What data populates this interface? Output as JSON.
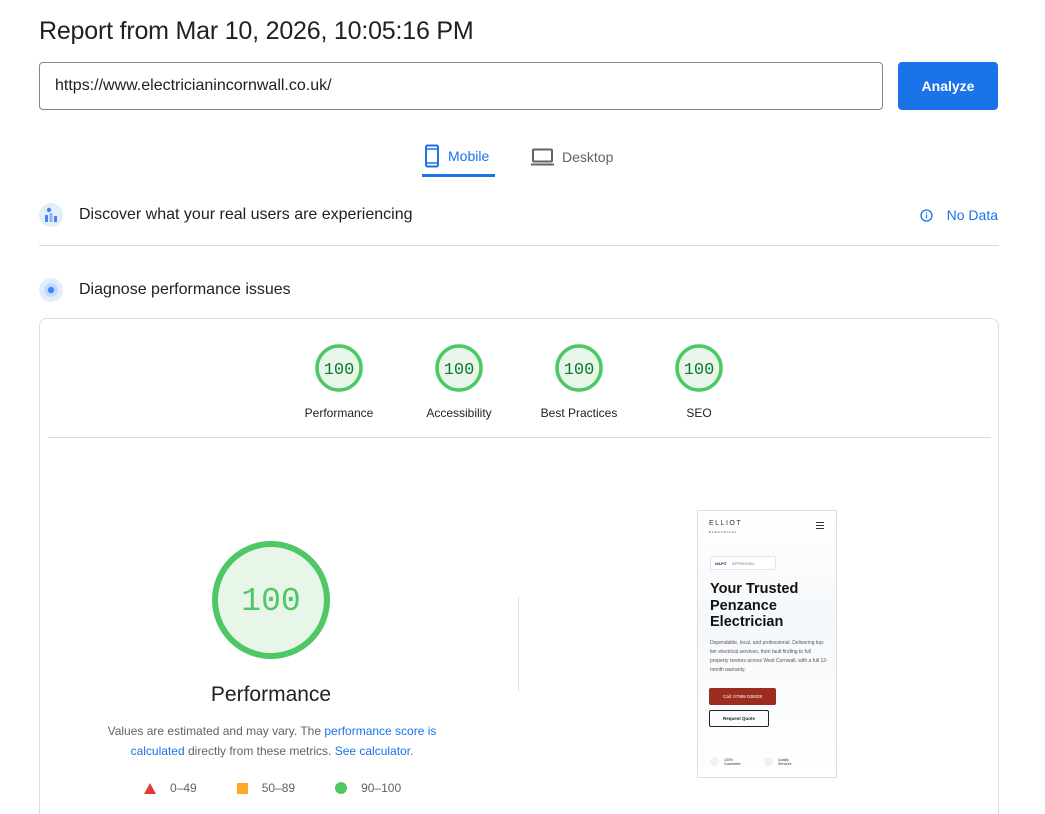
{
  "report": {
    "title": "Report from Mar 10, 2026, 10:05:16 PM"
  },
  "url_input": {
    "value": "https://www.electricianincornwall.co.uk/"
  },
  "analyze_button": {
    "label": "Analyze"
  },
  "tabs": [
    {
      "label": "Mobile",
      "icon": "mobile-icon",
      "selected": true
    },
    {
      "label": "Desktop",
      "icon": "desktop-icon",
      "selected": false
    }
  ],
  "field_data": {
    "title": "Discover what your real users are experiencing",
    "status": "No Data",
    "status_icon": "info-icon"
  },
  "lab_data": {
    "title": "Diagnose performance issues"
  },
  "categories": [
    {
      "label": "Performance",
      "score": "100",
      "fraction": 1.0
    },
    {
      "label": "Accessibility",
      "score": "100",
      "fraction": 1.0
    },
    {
      "label": "Best Practices",
      "score": "100",
      "fraction": 1.0
    },
    {
      "label": "SEO",
      "score": "100",
      "fraction": 1.0
    }
  ],
  "performance": {
    "score": "100",
    "fraction": 1.0,
    "title": "Performance",
    "desc_prefix": "Values are estimated and may vary. The ",
    "desc_link1": "performance score is calculated",
    "desc_mid": " directly from these metrics. ",
    "desc_link2": "See calculator."
  },
  "legend": [
    {
      "range": "0–49",
      "shape": "triangle",
      "color": "#e53935"
    },
    {
      "range": "50–89",
      "shape": "square",
      "color": "#ffa726"
    },
    {
      "range": "90–100",
      "shape": "circle",
      "color": "#43a047"
    }
  ],
  "colors": {
    "accent": "#1a73e8",
    "pass_ring": "#4ec765",
    "pass_fill": "#e8f5e9",
    "pass_text": "#0d7c34"
  },
  "screenshot_preview": {
    "logo": "ELLIOT",
    "logo_sub": "ELECTRICAL",
    "badge_brand": "NAPIT",
    "badge_text": "APPROVED",
    "headline": "Your Trusted Penzance Electrician",
    "body": "Dependable, local, and professional. Delivering top-tier electrical services, from fault finding to full property rewires across West Cornwall, with a full 12-month warranty.",
    "cta": "Call: 07999 039328",
    "secondary": "Request Quote",
    "feature1": "100% Guarantee",
    "feature2": "Quality Services"
  }
}
